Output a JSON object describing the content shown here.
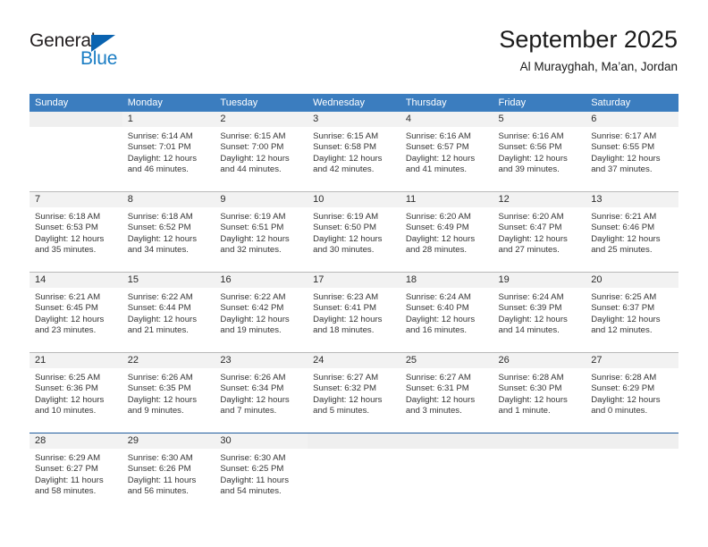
{
  "brand": {
    "logo_name_part1": "General",
    "logo_name_part2": "Blue",
    "triangle_icon": "blue-triangle-icon",
    "accent_color": "#1a7dc4",
    "header_color": "#3b7dbf"
  },
  "header": {
    "title": "September 2025",
    "subtitle": "Al Murayghah, Ma’an, Jordan"
  },
  "calendar": {
    "weekday_headers": [
      "Sunday",
      "Monday",
      "Tuesday",
      "Wednesday",
      "Thursday",
      "Friday",
      "Saturday"
    ],
    "weeks": [
      [
        {
          "day": "",
          "sunrise": "",
          "sunset": "",
          "daylight_line1": "",
          "daylight_line2": "",
          "empty": true
        },
        {
          "day": "1",
          "sunrise": "Sunrise: 6:14 AM",
          "sunset": "Sunset: 7:01 PM",
          "daylight_line1": "Daylight: 12 hours",
          "daylight_line2": "and 46 minutes."
        },
        {
          "day": "2",
          "sunrise": "Sunrise: 6:15 AM",
          "sunset": "Sunset: 7:00 PM",
          "daylight_line1": "Daylight: 12 hours",
          "daylight_line2": "and 44 minutes."
        },
        {
          "day": "3",
          "sunrise": "Sunrise: 6:15 AM",
          "sunset": "Sunset: 6:58 PM",
          "daylight_line1": "Daylight: 12 hours",
          "daylight_line2": "and 42 minutes."
        },
        {
          "day": "4",
          "sunrise": "Sunrise: 6:16 AM",
          "sunset": "Sunset: 6:57 PM",
          "daylight_line1": "Daylight: 12 hours",
          "daylight_line2": "and 41 minutes."
        },
        {
          "day": "5",
          "sunrise": "Sunrise: 6:16 AM",
          "sunset": "Sunset: 6:56 PM",
          "daylight_line1": "Daylight: 12 hours",
          "daylight_line2": "and 39 minutes."
        },
        {
          "day": "6",
          "sunrise": "Sunrise: 6:17 AM",
          "sunset": "Sunset: 6:55 PM",
          "daylight_line1": "Daylight: 12 hours",
          "daylight_line2": "and 37 minutes."
        }
      ],
      [
        {
          "day": "7",
          "sunrise": "Sunrise: 6:18 AM",
          "sunset": "Sunset: 6:53 PM",
          "daylight_line1": "Daylight: 12 hours",
          "daylight_line2": "and 35 minutes."
        },
        {
          "day": "8",
          "sunrise": "Sunrise: 6:18 AM",
          "sunset": "Sunset: 6:52 PM",
          "daylight_line1": "Daylight: 12 hours",
          "daylight_line2": "and 34 minutes."
        },
        {
          "day": "9",
          "sunrise": "Sunrise: 6:19 AM",
          "sunset": "Sunset: 6:51 PM",
          "daylight_line1": "Daylight: 12 hours",
          "daylight_line2": "and 32 minutes."
        },
        {
          "day": "10",
          "sunrise": "Sunrise: 6:19 AM",
          "sunset": "Sunset: 6:50 PM",
          "daylight_line1": "Daylight: 12 hours",
          "daylight_line2": "and 30 minutes."
        },
        {
          "day": "11",
          "sunrise": "Sunrise: 6:20 AM",
          "sunset": "Sunset: 6:49 PM",
          "daylight_line1": "Daylight: 12 hours",
          "daylight_line2": "and 28 minutes."
        },
        {
          "day": "12",
          "sunrise": "Sunrise: 6:20 AM",
          "sunset": "Sunset: 6:47 PM",
          "daylight_line1": "Daylight: 12 hours",
          "daylight_line2": "and 27 minutes."
        },
        {
          "day": "13",
          "sunrise": "Sunrise: 6:21 AM",
          "sunset": "Sunset: 6:46 PM",
          "daylight_line1": "Daylight: 12 hours",
          "daylight_line2": "and 25 minutes."
        }
      ],
      [
        {
          "day": "14",
          "sunrise": "Sunrise: 6:21 AM",
          "sunset": "Sunset: 6:45 PM",
          "daylight_line1": "Daylight: 12 hours",
          "daylight_line2": "and 23 minutes."
        },
        {
          "day": "15",
          "sunrise": "Sunrise: 6:22 AM",
          "sunset": "Sunset: 6:44 PM",
          "daylight_line1": "Daylight: 12 hours",
          "daylight_line2": "and 21 minutes."
        },
        {
          "day": "16",
          "sunrise": "Sunrise: 6:22 AM",
          "sunset": "Sunset: 6:42 PM",
          "daylight_line1": "Daylight: 12 hours",
          "daylight_line2": "and 19 minutes."
        },
        {
          "day": "17",
          "sunrise": "Sunrise: 6:23 AM",
          "sunset": "Sunset: 6:41 PM",
          "daylight_line1": "Daylight: 12 hours",
          "daylight_line2": "and 18 minutes."
        },
        {
          "day": "18",
          "sunrise": "Sunrise: 6:24 AM",
          "sunset": "Sunset: 6:40 PM",
          "daylight_line1": "Daylight: 12 hours",
          "daylight_line2": "and 16 minutes."
        },
        {
          "day": "19",
          "sunrise": "Sunrise: 6:24 AM",
          "sunset": "Sunset: 6:39 PM",
          "daylight_line1": "Daylight: 12 hours",
          "daylight_line2": "and 14 minutes."
        },
        {
          "day": "20",
          "sunrise": "Sunrise: 6:25 AM",
          "sunset": "Sunset: 6:37 PM",
          "daylight_line1": "Daylight: 12 hours",
          "daylight_line2": "and 12 minutes."
        }
      ],
      [
        {
          "day": "21",
          "sunrise": "Sunrise: 6:25 AM",
          "sunset": "Sunset: 6:36 PM",
          "daylight_line1": "Daylight: 12 hours",
          "daylight_line2": "and 10 minutes."
        },
        {
          "day": "22",
          "sunrise": "Sunrise: 6:26 AM",
          "sunset": "Sunset: 6:35 PM",
          "daylight_line1": "Daylight: 12 hours",
          "daylight_line2": "and 9 minutes."
        },
        {
          "day": "23",
          "sunrise": "Sunrise: 6:26 AM",
          "sunset": "Sunset: 6:34 PM",
          "daylight_line1": "Daylight: 12 hours",
          "daylight_line2": "and 7 minutes."
        },
        {
          "day": "24",
          "sunrise": "Sunrise: 6:27 AM",
          "sunset": "Sunset: 6:32 PM",
          "daylight_line1": "Daylight: 12 hours",
          "daylight_line2": "and 5 minutes."
        },
        {
          "day": "25",
          "sunrise": "Sunrise: 6:27 AM",
          "sunset": "Sunset: 6:31 PM",
          "daylight_line1": "Daylight: 12 hours",
          "daylight_line2": "and 3 minutes."
        },
        {
          "day": "26",
          "sunrise": "Sunrise: 6:28 AM",
          "sunset": "Sunset: 6:30 PM",
          "daylight_line1": "Daylight: 12 hours",
          "daylight_line2": "and 1 minute."
        },
        {
          "day": "27",
          "sunrise": "Sunrise: 6:28 AM",
          "sunset": "Sunset: 6:29 PM",
          "daylight_line1": "Daylight: 12 hours",
          "daylight_line2": "and 0 minutes."
        }
      ],
      [
        {
          "day": "28",
          "sunrise": "Sunrise: 6:29 AM",
          "sunset": "Sunset: 6:27 PM",
          "daylight_line1": "Daylight: 11 hours",
          "daylight_line2": "and 58 minutes."
        },
        {
          "day": "29",
          "sunrise": "Sunrise: 6:30 AM",
          "sunset": "Sunset: 6:26 PM",
          "daylight_line1": "Daylight: 11 hours",
          "daylight_line2": "and 56 minutes."
        },
        {
          "day": "30",
          "sunrise": "Sunrise: 6:30 AM",
          "sunset": "Sunset: 6:25 PM",
          "daylight_line1": "Daylight: 11 hours",
          "daylight_line2": "and 54 minutes."
        },
        {
          "day": "",
          "sunrise": "",
          "sunset": "",
          "daylight_line1": "",
          "daylight_line2": "",
          "empty": true
        },
        {
          "day": "",
          "sunrise": "",
          "sunset": "",
          "daylight_line1": "",
          "daylight_line2": "",
          "empty": true
        },
        {
          "day": "",
          "sunrise": "",
          "sunset": "",
          "daylight_line1": "",
          "daylight_line2": "",
          "empty": true
        },
        {
          "day": "",
          "sunrise": "",
          "sunset": "",
          "daylight_line1": "",
          "daylight_line2": "",
          "empty": true
        }
      ]
    ]
  }
}
